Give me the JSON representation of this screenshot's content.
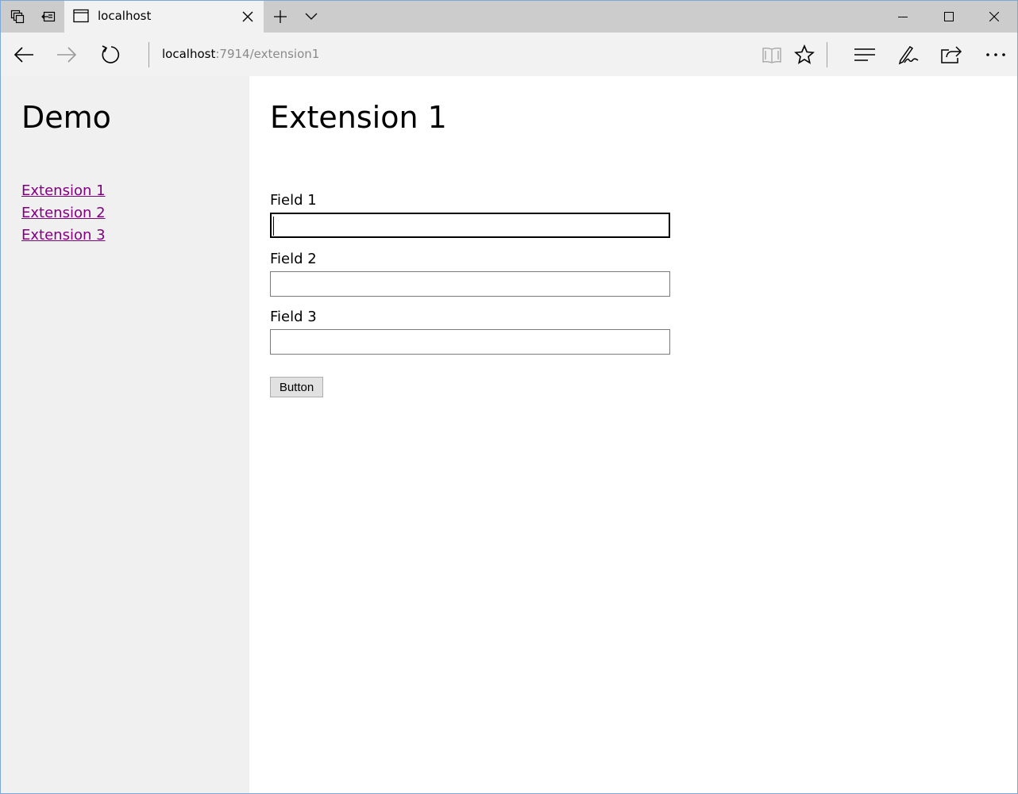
{
  "browser": {
    "tab": {
      "title": "localhost"
    },
    "url": {
      "host": "localhost",
      "rest": ":7914/extension1"
    },
    "icons": {
      "tab_actions": "tabs-aside-icon",
      "restore_tabs": "restore-tabs-icon",
      "favicon": "page-icon",
      "close_tab": "close-icon",
      "new_tab": "plus-icon",
      "tab_list": "chevron-down-icon",
      "minimize": "minimize-icon",
      "maximize": "maximize-icon",
      "close_window": "close-icon",
      "back": "arrow-left-icon",
      "forward": "arrow-right-icon",
      "refresh": "refresh-icon",
      "reading_view": "book-icon",
      "favorites": "star-icon",
      "hub": "hub-icon",
      "web_note": "pen-icon",
      "share": "share-icon",
      "more": "more-icon"
    }
  },
  "sidebar": {
    "title": "Demo",
    "links": [
      {
        "label": "Extension 1"
      },
      {
        "label": "Extension 2"
      },
      {
        "label": "Extension 3"
      }
    ],
    "link_color": "#800080"
  },
  "main": {
    "title": "Extension 1",
    "fields": [
      {
        "label": "Field 1",
        "value": ""
      },
      {
        "label": "Field 2",
        "value": ""
      },
      {
        "label": "Field 3",
        "value": ""
      }
    ],
    "button_label": "Button"
  }
}
